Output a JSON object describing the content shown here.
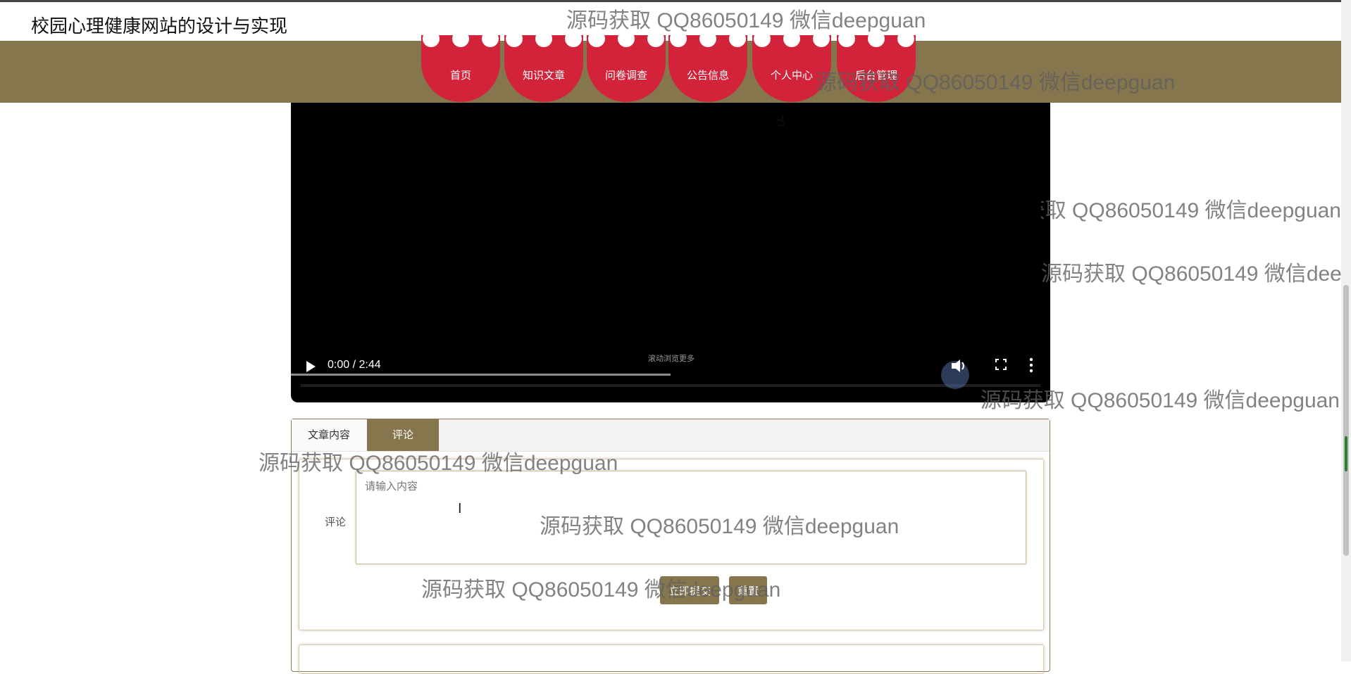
{
  "site_title": "校园心理健康网站的设计与实现",
  "nav": {
    "items": [
      {
        "label": "首页"
      },
      {
        "label": "知识文章"
      },
      {
        "label": "问卷调查"
      },
      {
        "label": "公告信息"
      },
      {
        "label": "个人中心"
      },
      {
        "label": "后台管理"
      }
    ]
  },
  "video": {
    "time": "0:00 / 2:44",
    "scroll_hint": "滚动浏览更多",
    "progress_fraction": 0.5
  },
  "tabs": [
    {
      "label": "文章内容",
      "active": false
    },
    {
      "label": "评论",
      "active": true
    }
  ],
  "comment_form": {
    "label": "评论",
    "placeholder": "请输入内容",
    "submit_label": "立即提交",
    "reset_label": "重置"
  },
  "watermark": "源码获取 QQ86050149 微信deepguan",
  "colors": {
    "nav_band": "#86764e",
    "nav_item": "#d2233a",
    "accent": "#86764e"
  },
  "icons": [
    "play-icon",
    "volume-icon",
    "fullscreen-icon",
    "more-options-icon",
    "hand-cursor-icon",
    "text-cursor-icon"
  ]
}
